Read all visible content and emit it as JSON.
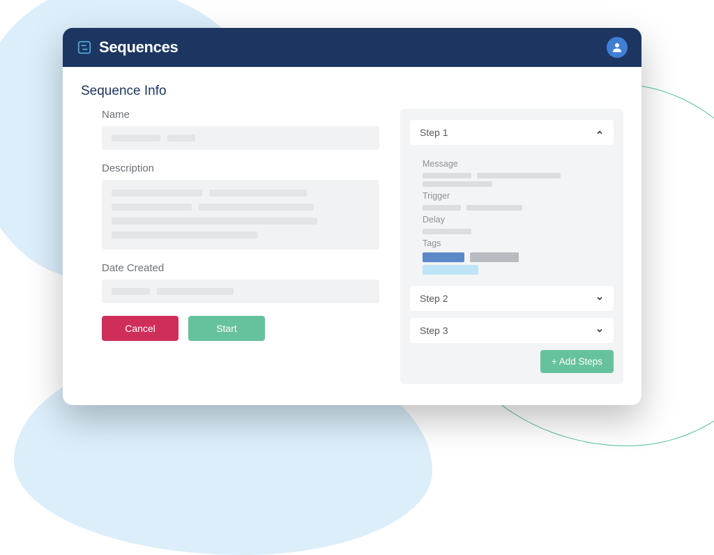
{
  "header": {
    "title": "Sequences"
  },
  "page": {
    "section_title": "Sequence Info",
    "labels": {
      "name": "Name",
      "description": "Description",
      "date_created": "Date Created"
    },
    "buttons": {
      "cancel": "Cancel",
      "start": "Start",
      "add_steps": "+ Add Steps"
    }
  },
  "steps": [
    {
      "title": "Step 1",
      "expanded": true,
      "fields": {
        "message": "Message",
        "trigger": "Trigger",
        "delay": "Delay",
        "tags": "Tags"
      }
    },
    {
      "title": "Step 2",
      "expanded": false
    },
    {
      "title": "Step 3",
      "expanded": false
    }
  ],
  "colors": {
    "header_bg": "#1c3661",
    "cancel": "#cf2d5a",
    "start": "#66c29c",
    "blob_fill": "#dbeefa",
    "blob_stroke": "#4fbf9f"
  }
}
